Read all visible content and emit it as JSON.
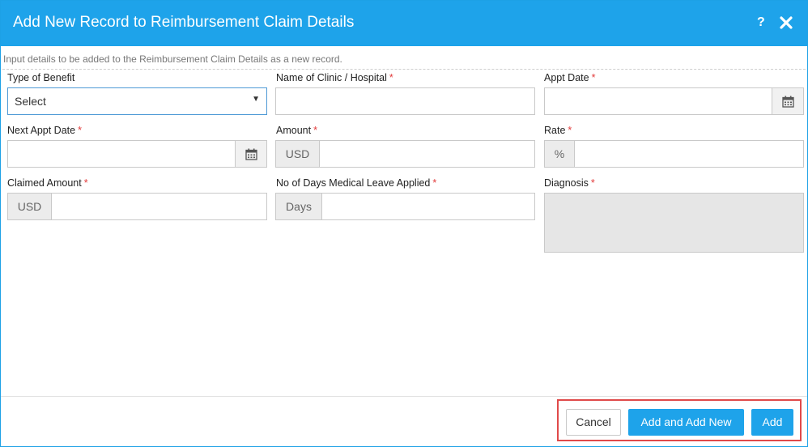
{
  "dialog": {
    "title": "Add New Record to Reimbursement Claim Details",
    "help_symbol": "?",
    "description": "Input details to be added to the Reimbursement Claim Details as a new record."
  },
  "fields": {
    "type_of_benefit": {
      "label": "Type of Benefit",
      "selected": "Select",
      "caret": "▼"
    },
    "clinic": {
      "label": "Name of Clinic / Hospital",
      "required": "*"
    },
    "appt_date": {
      "label": "Appt Date",
      "required": "*"
    },
    "next_appt_date": {
      "label": "Next Appt Date",
      "required": "*"
    },
    "amount": {
      "label": "Amount",
      "required": "*",
      "addon": "USD"
    },
    "rate": {
      "label": "Rate",
      "required": "*",
      "addon": "%"
    },
    "claimed_amount": {
      "label": "Claimed Amount",
      "required": "*",
      "addon": "USD"
    },
    "medical_leave": {
      "label": "No of Days Medical Leave Applied",
      "required": "*",
      "addon": "Days"
    },
    "diagnosis": {
      "label": "Diagnosis",
      "required": "*"
    }
  },
  "footer": {
    "cancel_label": "Cancel",
    "add_and_add_new_label": "Add and Add New",
    "add_label": "Add"
  },
  "icons": {
    "help": "help-icon",
    "close": "close-icon",
    "calendar": "calendar-icon"
  },
  "colors": {
    "header": "#1ea3ea",
    "primary_button": "#1ea3ea",
    "required": "#e23b3b",
    "highlight_border": "#e04a4a"
  }
}
